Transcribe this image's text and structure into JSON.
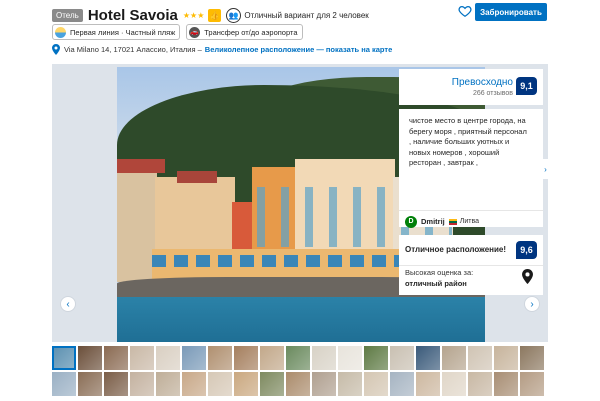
{
  "header": {
    "type_badge": "Отель",
    "hotel_name": "Hotel Savoia",
    "stars": "★★★",
    "star_count": 3,
    "couple_text": "Отличный вариант для 2 человек",
    "book_label": "Забронировать"
  },
  "chips": [
    {
      "label": "Первая линия · Частный пляж",
      "icon": "beach-umbrella-icon"
    },
    {
      "label": "Трансфер от/до аэропорта",
      "icon": "car-icon"
    }
  ],
  "address": {
    "text": "Via Milano 14, 17021 Алассио, Италия –",
    "link": "Великолепное расположение — показать на карте"
  },
  "gallery": {
    "prev_arrow": "‹",
    "next_arrow": "›"
  },
  "score": {
    "label": "Превосходно",
    "reviews": "266 отзывов",
    "value": "9,1"
  },
  "review": {
    "text": "чистое место в центре города, на берегу моря , приятный персонал , наличие больших уютных и новых номеров , хороший ресторан , завтрак ,",
    "initial": "D",
    "name": "Dmitrij",
    "country": "Литва",
    "next_arrow": "›"
  },
  "location": {
    "title": "Отличное расположение!",
    "score": "9,6",
    "sub1": "Высокая оценка за:",
    "sub2": "отличный район"
  },
  "colors": {
    "accent": "#0071c2",
    "score_bg": "#003580",
    "star": "#febb02"
  },
  "thumbnails": [
    "#5a8fb0",
    "#6b4f3a",
    "#8a6a52",
    "#c9b8a6",
    "#d9cfc2",
    "#7a9ab8",
    "#b09070",
    "#a57f5e",
    "#c2a88a",
    "#6a8a5e",
    "#d8d2c6",
    "#e8e4dc",
    "#5e7a44",
    "#c9c0b2",
    "#3a5a7a",
    "#b5a48e",
    "#d0c4b4",
    "#c7b49c",
    "#8c7860",
    "#9ab0c4",
    "#8a6e56",
    "#7b5e48",
    "#c4b2a0",
    "#bfae98",
    "#c8a888",
    "#d6c8b6",
    "#caa880",
    "#7e8a60",
    "#ab8c6c",
    "#b0a090",
    "#c6bba8",
    "#d4c6b2",
    "#a6b4c2",
    "#cdb8a0",
    "#e0d6c8",
    "#c8b8a4",
    "#a88e74",
    "#b49c84"
  ]
}
